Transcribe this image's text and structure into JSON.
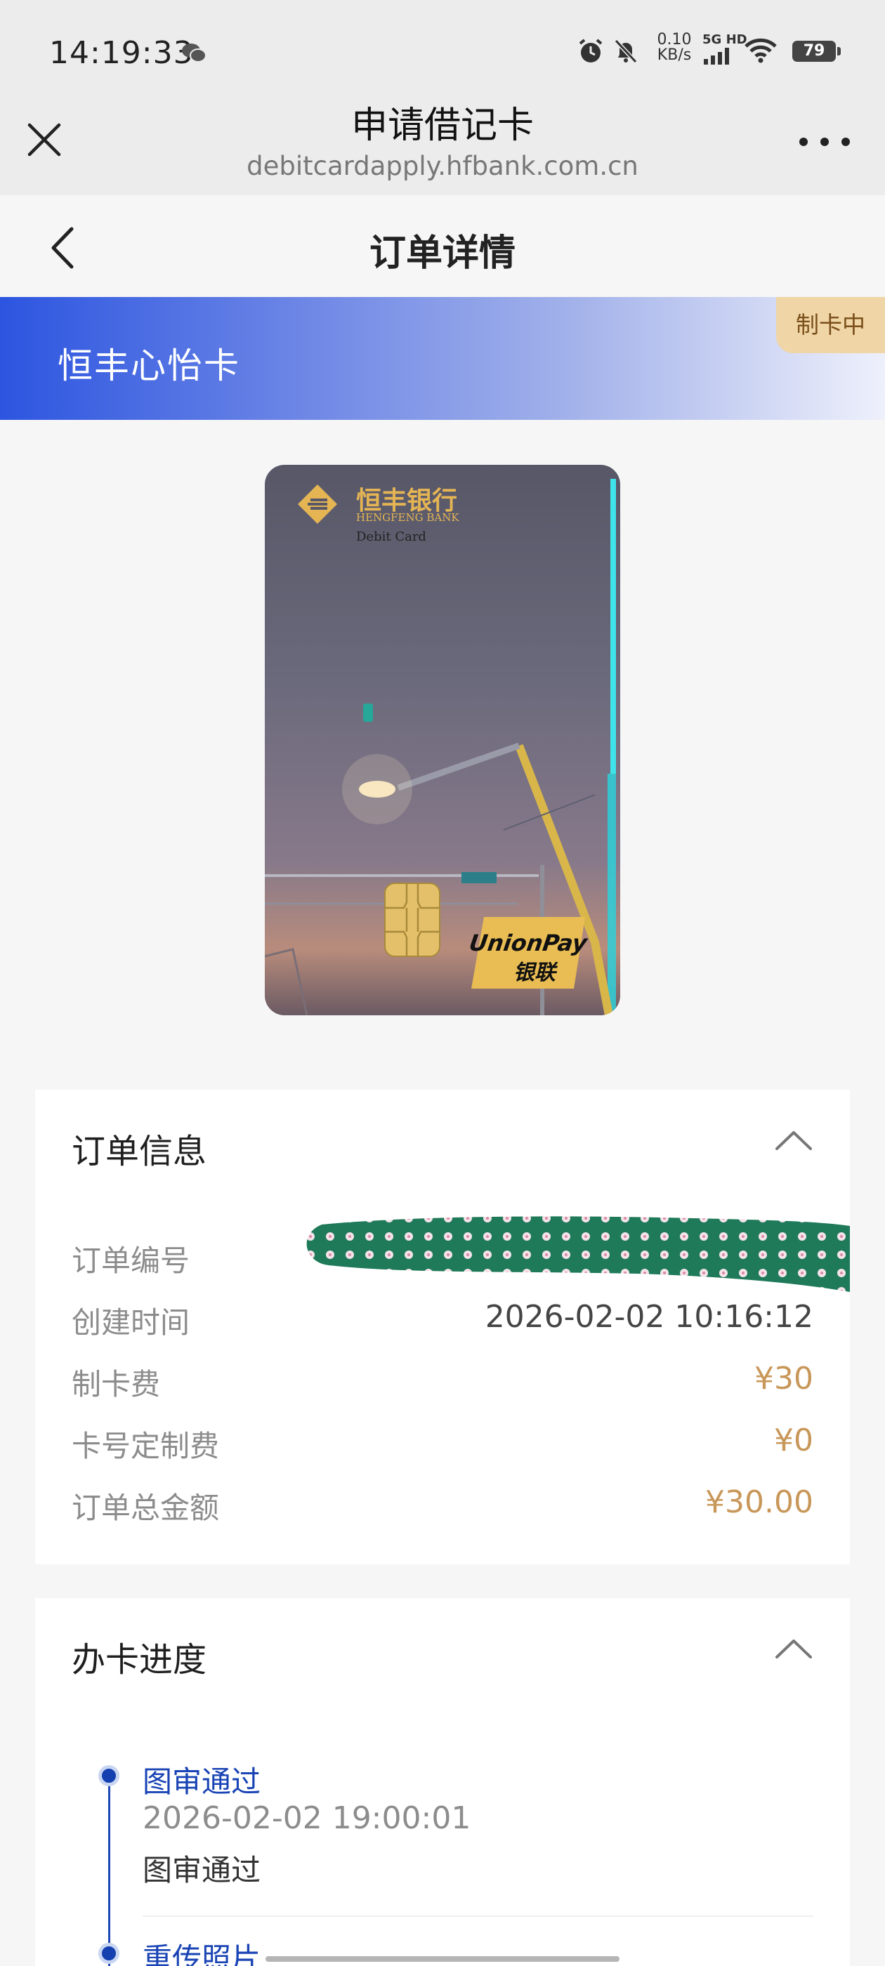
{
  "status_bar": {
    "time": "14:19:33",
    "net_speed_value": "0.10",
    "net_speed_unit": "KB/s",
    "signal_label": "5G HD",
    "battery": "79",
    "icons": [
      "wechat-icon",
      "alarm-icon",
      "mute-icon",
      "signal-icon",
      "wifi-icon",
      "battery-icon"
    ]
  },
  "browser": {
    "title": "申请借记卡",
    "url": "debitcardapply.hfbank.com.cn"
  },
  "page": {
    "title": "订单详情"
  },
  "card": {
    "name": "恒丰心怡卡",
    "status_badge": "制卡中",
    "bank_name_cn": "恒丰银行",
    "bank_name_en": "HENGFENG BANK",
    "card_type": "Debit Card",
    "network_logo": "UnionPay",
    "network_logo_cn": "银联",
    "colors": {
      "banner_start": "#2c55e0",
      "banner_end": "#eef0fb",
      "badge_bg": "#f0d5a6",
      "logo_gold": "#e5b554"
    }
  },
  "order_info": {
    "title": "订单信息",
    "rows": [
      {
        "label": "订单编号",
        "value": ""
      },
      {
        "label": "创建时间",
        "value": "2026-02-02 10:16:12"
      },
      {
        "label": "制卡费",
        "value": "¥30"
      },
      {
        "label": "卡号定制费",
        "value": "¥0"
      },
      {
        "label": "订单总金额",
        "value": "¥30.00"
      }
    ],
    "price_color": "#c8975a"
  },
  "progress": {
    "title": "办卡进度",
    "steps": [
      {
        "title": "图审通过",
        "time": "2026-02-02 19:00:01",
        "desc": "图审通过"
      },
      {
        "title": "重传照片"
      }
    ],
    "accent_color": "#1440b0"
  }
}
